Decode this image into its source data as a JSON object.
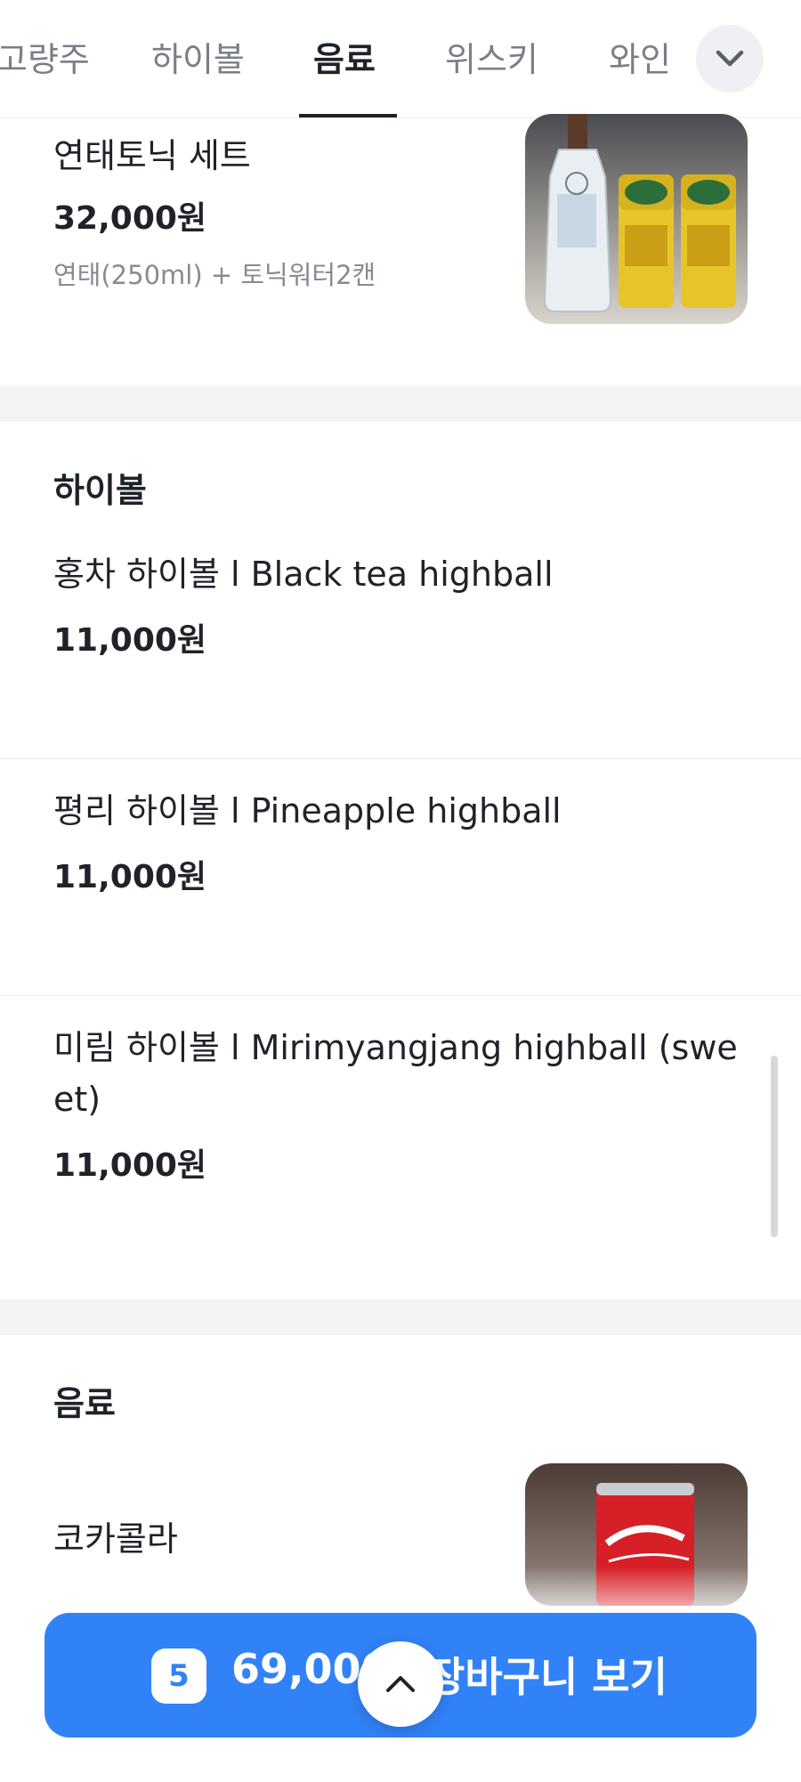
{
  "tabs": [
    {
      "label": "고량주",
      "active": false
    },
    {
      "label": "하이볼",
      "active": false
    },
    {
      "label": "음료",
      "active": true
    },
    {
      "label": "위스키",
      "active": false
    },
    {
      "label": "와인",
      "active": false
    }
  ],
  "more_icon": "chevron-down-icon",
  "set_item": {
    "name": "연태토닉 세트",
    "price": "32,000원",
    "description": "연태(250ml) + 토닉워터2캔",
    "image": "yantai-bottle-and-tonic-cans"
  },
  "highball_section": {
    "title": "하이볼",
    "items": [
      {
        "name": "홍차 하이볼 l Black tea highball",
        "price": "11,000원"
      },
      {
        "name": "평리 하이볼 l Pineapple highball",
        "price": "11,000원"
      },
      {
        "name": "미림 하이볼 l Mirimyangjang highball (swe et)",
        "price": "11,000원"
      }
    ]
  },
  "drinks_section": {
    "title": "음료",
    "items": [
      {
        "name": "코카콜라",
        "image": "coca-cola-can"
      }
    ]
  },
  "cart": {
    "count": "5",
    "total": "69,000",
    "label": "장바구니 보기",
    "color": "#3182f6"
  },
  "scroll_top_icon": "chevron-up-icon"
}
